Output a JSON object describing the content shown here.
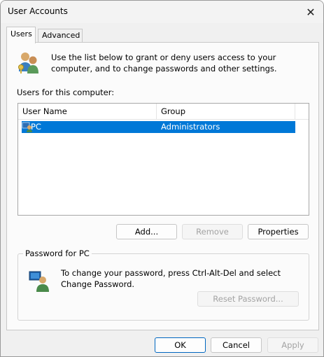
{
  "window": {
    "title": "User Accounts",
    "close_symbol": "✕"
  },
  "tabs": [
    {
      "label": "Users",
      "active": true
    },
    {
      "label": "Advanced",
      "active": false
    }
  ],
  "intro": {
    "icon": "users-icon",
    "text": "Use the list below to grant or deny users access to your computer, and to change passwords and other settings."
  },
  "users_list": {
    "label": "Users for this computer:",
    "columns": [
      "User Name",
      "Group"
    ],
    "rows": [
      {
        "name": "PC",
        "group": "Administrators",
        "selected": true
      }
    ]
  },
  "user_buttons": {
    "add": "Add...",
    "remove": "Remove",
    "properties": "Properties"
  },
  "password": {
    "legend": "Password for PC",
    "text": "To change your password, press Ctrl-Alt-Del and select Change Password.",
    "reset_button": "Reset Password..."
  },
  "dialog_buttons": {
    "ok": "OK",
    "cancel": "Cancel",
    "apply": "Apply"
  },
  "colors": {
    "selection": "#0078d7",
    "ok_border": "#0067c0"
  }
}
